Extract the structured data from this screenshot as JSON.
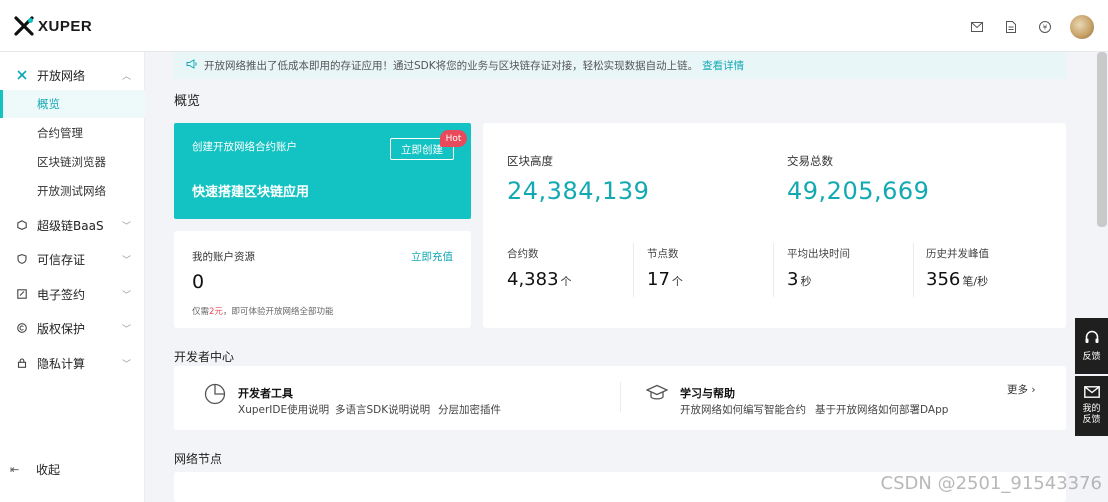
{
  "colors": {
    "accent": "#13c2c2",
    "accent_text": "#13a9b3",
    "hot": "#e8495b"
  },
  "topbar": {
    "logo_text": "XUPER",
    "icons": [
      "mail-icon",
      "document-icon",
      "currency-icon"
    ]
  },
  "sidebar": {
    "groups": [
      {
        "label": "开放网络",
        "icon": "network-icon",
        "expanded": true,
        "items": [
          {
            "label": "概览",
            "active": true
          },
          {
            "label": "合约管理"
          },
          {
            "label": "区块链浏览器"
          },
          {
            "label": "开放测试网络"
          }
        ]
      },
      {
        "label": "超级链BaaS",
        "icon": "cube-icon"
      },
      {
        "label": "可信存证",
        "icon": "shield-icon"
      },
      {
        "label": "电子签约",
        "icon": "sign-icon"
      },
      {
        "label": "版权保护",
        "icon": "copyright-icon"
      },
      {
        "label": "隐私计算",
        "icon": "lock-icon"
      }
    ],
    "collapse_label": "收起"
  },
  "notice": {
    "text": "开放网络推出了低成本即用的存证应用！通过SDK将您的业务与区块链存证对接，轻松实现数据自动上链。",
    "link": "查看详情"
  },
  "overview": {
    "title": "概览",
    "promo": {
      "title": "创建开放网络合约账户",
      "button": "立即创建",
      "badge": "Hot",
      "slogan": "快速搭建区块链应用"
    },
    "account": {
      "label": "我的账户资源",
      "link": "立即充值",
      "value": "0",
      "note_prefix": "仅需",
      "note_price": "2元",
      "note_suffix": "，即可体验开放网络全部功能"
    },
    "stats": {
      "block_height_label": "区块高度",
      "block_height": "24,384,139",
      "tx_total_label": "交易总数",
      "tx_total": "49,205,669",
      "contracts_label": "合约数",
      "contracts": "4,383",
      "contracts_unit": "个",
      "nodes_label": "节点数",
      "nodes": "17",
      "nodes_unit": "个",
      "block_time_label": "平均出块时间",
      "block_time": "3",
      "block_time_unit": "秒",
      "peak_label": "历史并发峰值",
      "peak": "356",
      "peak_unit": "笔/秒"
    }
  },
  "developer": {
    "title": "开发者中心",
    "tools_title": "开发者工具",
    "tools_links": [
      "XuperIDE使用说明",
      "多语言SDK说明说明",
      "分层加密插件"
    ],
    "help_title": "学习与帮助",
    "help_links": [
      "开放网络如何编写智能合约",
      "基于开放网络如何部署DApp"
    ],
    "more": "更多 ›"
  },
  "nodes_title": "网络节点",
  "float": {
    "feedback": "反馈",
    "my_feedback": "我的反馈"
  },
  "watermark": "CSDN @2501_91543376"
}
